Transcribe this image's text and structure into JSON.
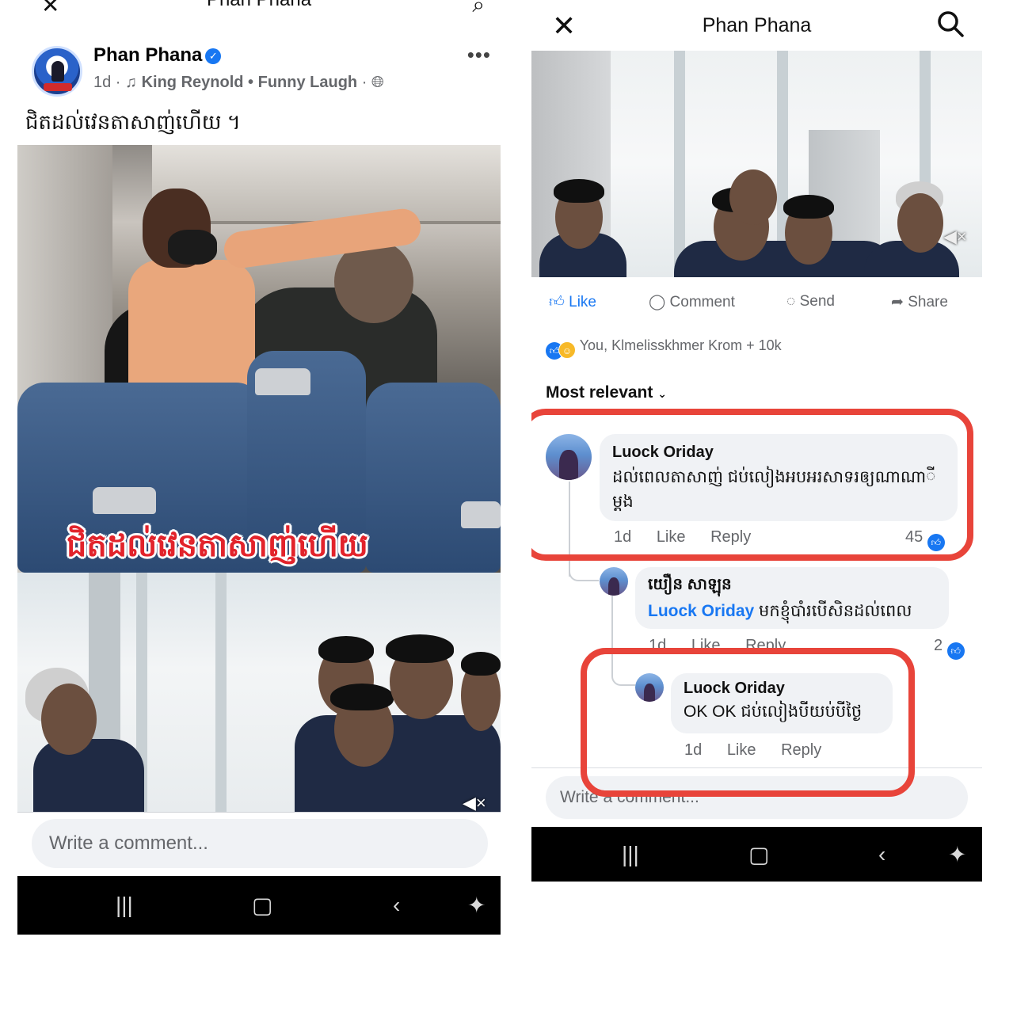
{
  "left": {
    "header": {
      "title": "Phan Phana"
    },
    "post": {
      "author": "Phan Phana",
      "time": "1d",
      "music": "King Reynold • Funny Laugh",
      "caption": "ជិតដល់វេនតាសាញ់ហើយ ។",
      "video_overlay": "ជិតដល់វេនតាសាញ់ហើយ"
    },
    "comment_placeholder": "Write a comment..."
  },
  "right": {
    "header": {
      "title": "Phan Phana"
    },
    "actions": {
      "like": "Like",
      "comment": "Comment",
      "send": "Send",
      "share": "Share"
    },
    "reactions_text": "You, Klmelisskhmer Krom + 10k",
    "sort_label": "Most relevant",
    "comments": [
      {
        "name": "Luock Oriday",
        "text": "ដល់ពេលតាសាញ់ ជប់លៀងអបអរសាទរឲ្យណាណាីម្តង",
        "time": "1d",
        "like": "Like",
        "reply": "Reply",
        "count": "45"
      },
      {
        "name": "យឿន សាឡុន",
        "mention": "Luock Oriday",
        "text": "មកខ្ញុំបាំរបើសិនដល់ពេល",
        "time": "1d",
        "like": "Like",
        "reply": "Reply",
        "count": "2"
      },
      {
        "name": "Luock Oriday",
        "text": "OK OK ជប់លៀងបីយប់បីថ្ងៃ",
        "time": "1d",
        "like": "Like",
        "reply": "Reply"
      }
    ],
    "comment_placeholder": "Write a comment..."
  },
  "colors": {
    "accent": "#1877f2",
    "highlight": "#e8443a"
  },
  "icons": [
    "close-icon",
    "search-icon",
    "verified-icon",
    "music-icon",
    "globe-icon",
    "more-icon",
    "like-icon",
    "comment-icon",
    "messenger-icon",
    "share-icon",
    "mute-icon",
    "recent-apps-icon",
    "home-icon",
    "back-icon",
    "accessibility-icon"
  ]
}
